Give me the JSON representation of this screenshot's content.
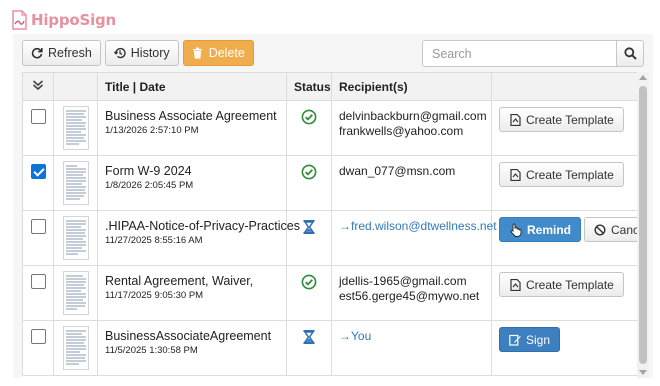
{
  "brand": {
    "name": "HippoSign"
  },
  "toolbar": {
    "refresh_label": "Refresh",
    "history_label": "History",
    "delete_label": "Delete",
    "search_placeholder": "Search"
  },
  "columns": {
    "select": "",
    "thumb": "",
    "title_date": "Title | Date",
    "status": "Status",
    "recipients": "Recipient(s)",
    "actions": ""
  },
  "rows": [
    {
      "checked": false,
      "title": "Business Associate Agreement",
      "date": "1/13/2026 2:57:10 PM",
      "status": "completed",
      "recipient_1": "delvinbackburn@gmail.com",
      "recipient_2": "frankwells@yahoo.com",
      "action_1": "Create Template"
    },
    {
      "checked": true,
      "title": "Form W-9 2024",
      "date": "1/8/2026 2:05:45 PM",
      "status": "completed",
      "recipient_1": "dwan_077@msn.com",
      "action_1": "Create Template"
    },
    {
      "checked": false,
      "title": ".HIPAA-Notice-of-Privacy-Practices",
      "date": "11/27/2025 8:55:16 AM",
      "status": "pending",
      "recipient_1": "→fred.wilson@dtwellness.net",
      "action_1": "Remind",
      "action_2": "Cancel"
    },
    {
      "checked": false,
      "title": "Rental Agreement, Waiver,",
      "date": "11/17/2025 9:05:30 PM",
      "status": "completed",
      "recipient_1": "jdellis-1965@gmail.com",
      "recipient_2": "est56.gerge45@mywo.net",
      "action_1": "Create Template"
    },
    {
      "checked": false,
      "title": "BusinessAssociateAgreement",
      "date": "11/5/2025 1:30:58 PM",
      "status": "pending",
      "recipient_1": "→You",
      "action_1": "Sign"
    }
  ],
  "colors": {
    "brand": "#e7909f",
    "delete_button": "#f0ad4e",
    "primary_button": "#428bca",
    "completed_status": "#2e8b3a",
    "pending_status": "#2e6fb4",
    "link": "#337ab7"
  },
  "icons": {
    "refresh": "refresh-icon",
    "history": "history-icon",
    "delete": "trash-icon",
    "search": "search-icon",
    "select_all": "double-check-icon",
    "completed": "check-circle-icon",
    "pending": "hourglass-icon",
    "template": "file-template-icon",
    "remind": "hand-pointer-icon",
    "cancel": "ban-icon",
    "sign": "sign-icon"
  }
}
